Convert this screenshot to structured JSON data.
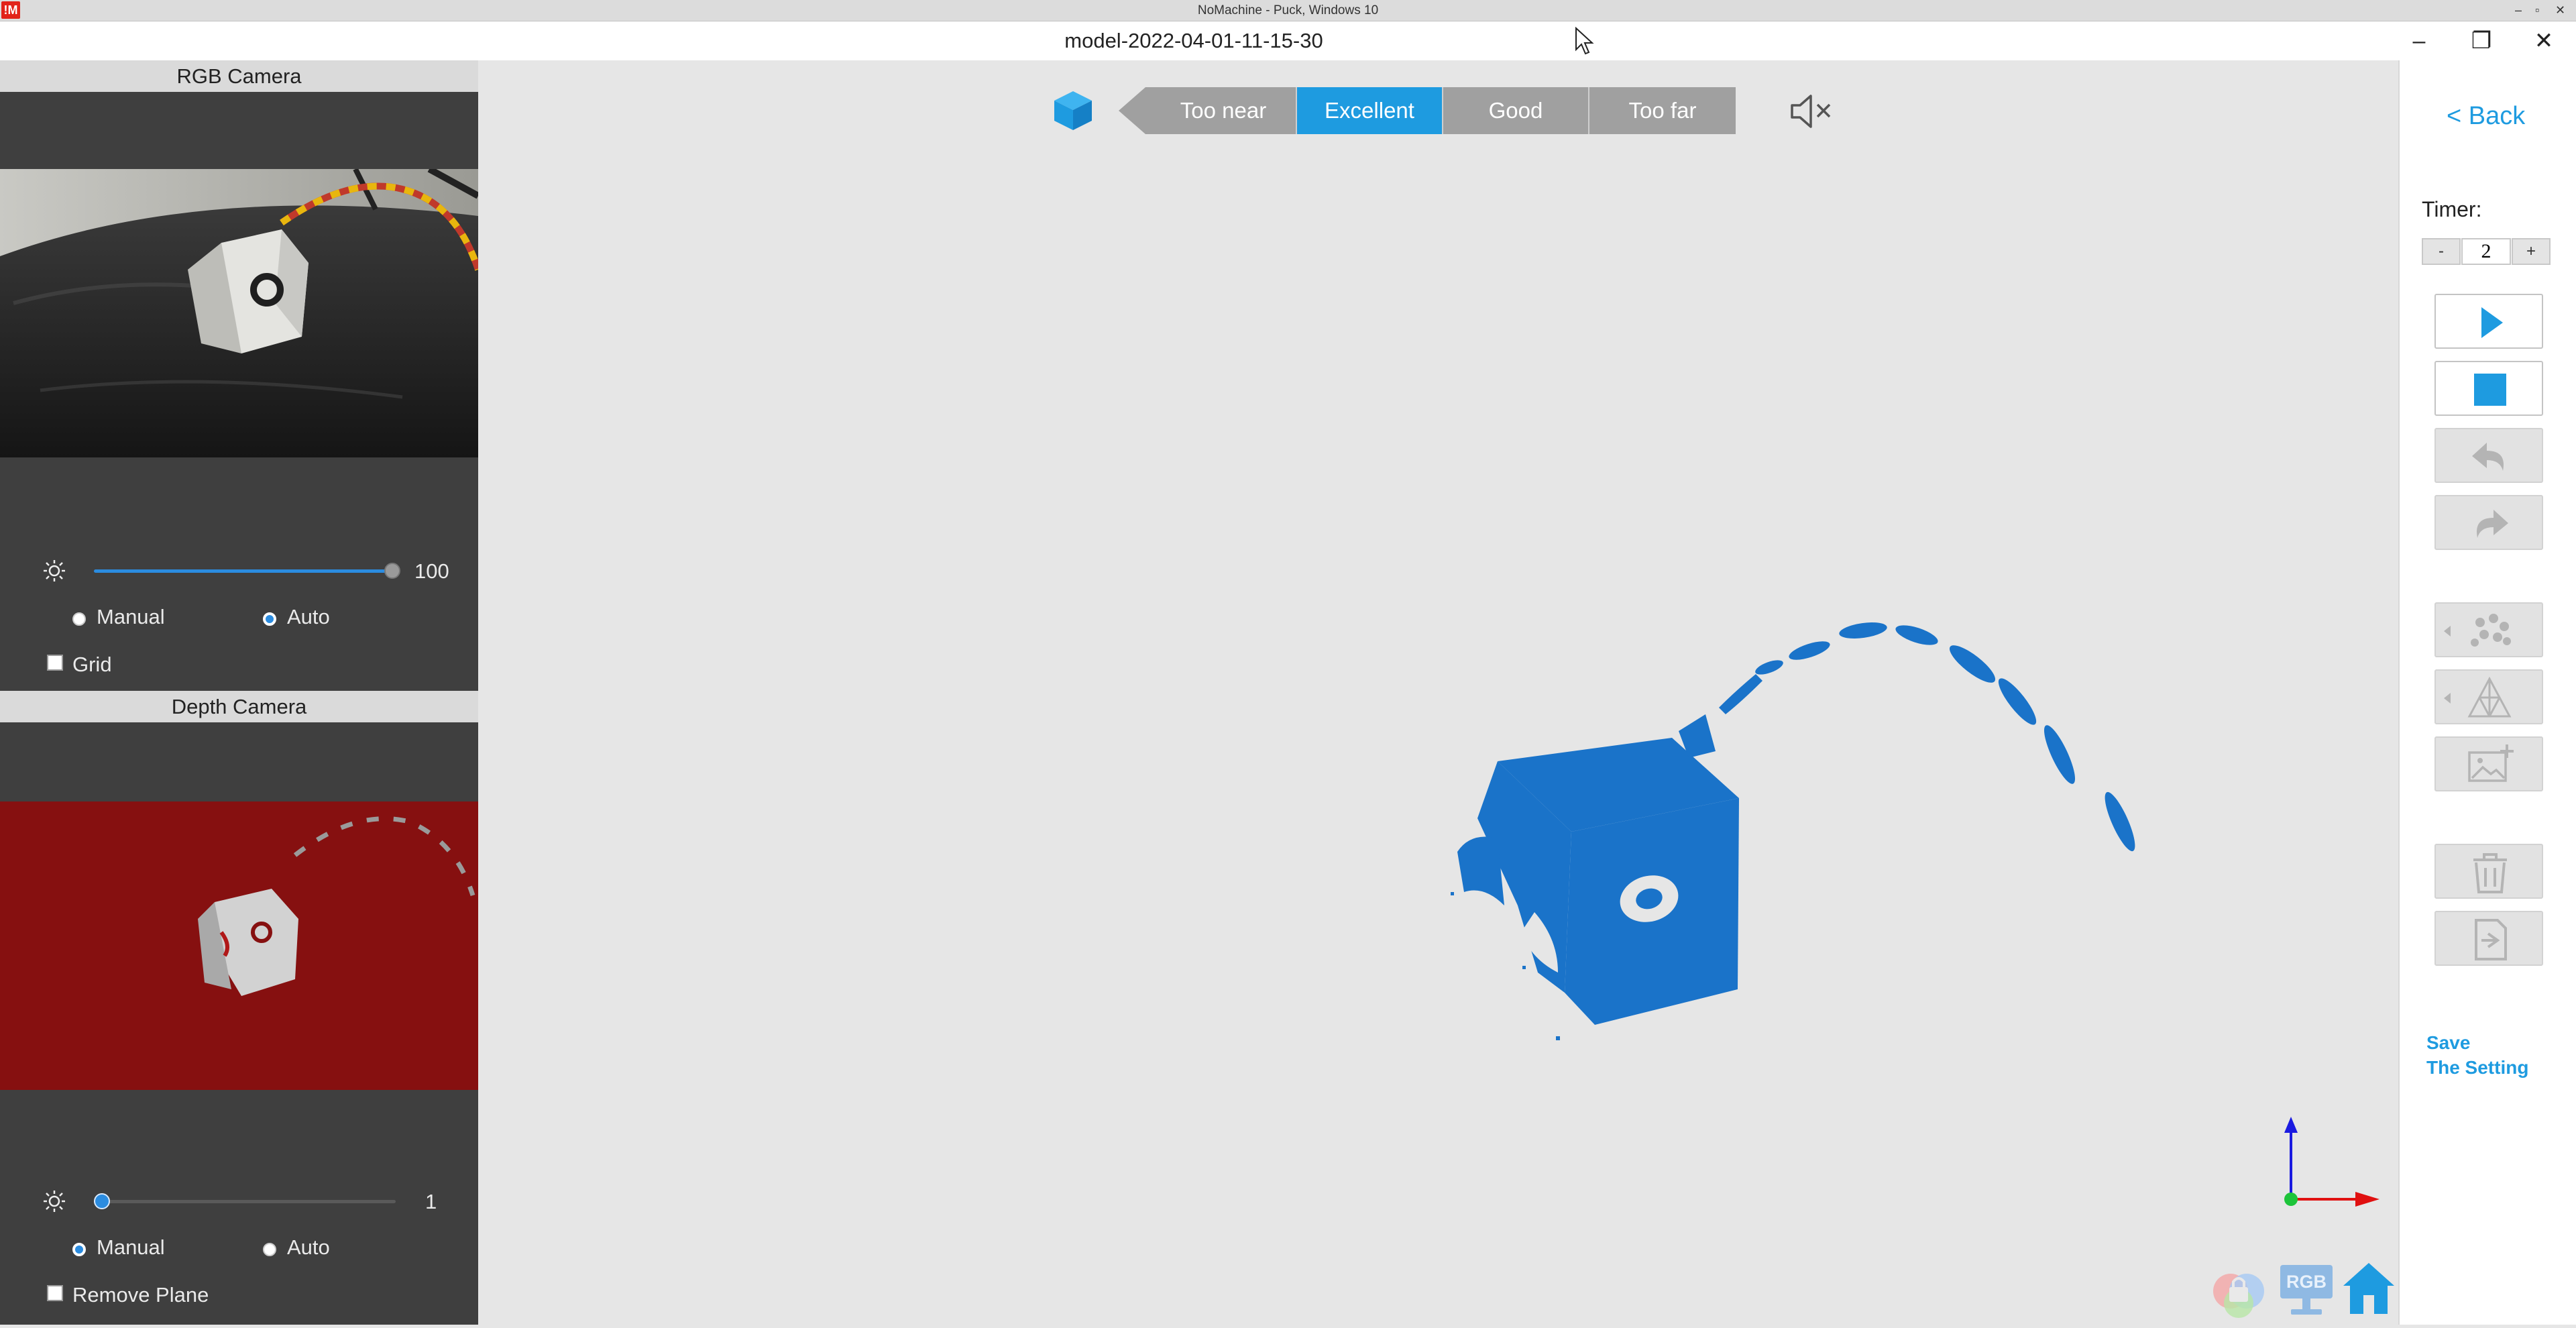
{
  "remote_session": {
    "logo": "!M",
    "title": "NoMachine - Puck, Windows 10"
  },
  "window": {
    "title": "model-2022-04-01-11-15-30",
    "minimize": "–",
    "maximize": "❐",
    "close": "✕"
  },
  "left_panel": {
    "rgb_camera": {
      "header": "RGB Camera",
      "brightness_value": "100",
      "brightness_level": 1.0,
      "mode_manual": "Manual",
      "mode_auto": "Auto",
      "selected_mode": "Auto",
      "grid_label": "Grid",
      "grid_checked": false
    },
    "depth_camera": {
      "header": "Depth Camera",
      "brightness_value": "1",
      "brightness_level": 0.0,
      "mode_manual": "Manual",
      "mode_auto": "Auto",
      "selected_mode": "Manual",
      "remove_plane_label": "Remove Plane",
      "remove_plane_checked": false
    }
  },
  "distance_bar": {
    "options": [
      "Too near",
      "Excellent",
      "Good",
      "Too far"
    ],
    "selected": "Excellent",
    "icons": [
      "cube-icon",
      "arrow-left-icon",
      "speaker-muted-icon"
    ]
  },
  "right_panel": {
    "back_label": "< Back",
    "timer_label": "Timer:",
    "timer_minus": "-",
    "timer_value": "2",
    "timer_plus": "+",
    "save_setting_line1": "Save",
    "save_setting_line2": "The Setting",
    "tools": [
      "play-icon",
      "stop-icon",
      "undo-icon",
      "redo-icon",
      "point-cloud-icon",
      "mesh-icon",
      "add-texture-icon",
      "delete-icon",
      "export-icon"
    ]
  },
  "bottom_dock": {
    "rgb_label": "RGB",
    "icons": [
      "lock-color-icon",
      "rgb-monitor-icon",
      "home-icon"
    ]
  },
  "colors": {
    "accent": "#1e9be0",
    "point_cloud": "#1a73c9",
    "depth_bg": "#861010",
    "panel_bg": "#3f3f3f"
  }
}
